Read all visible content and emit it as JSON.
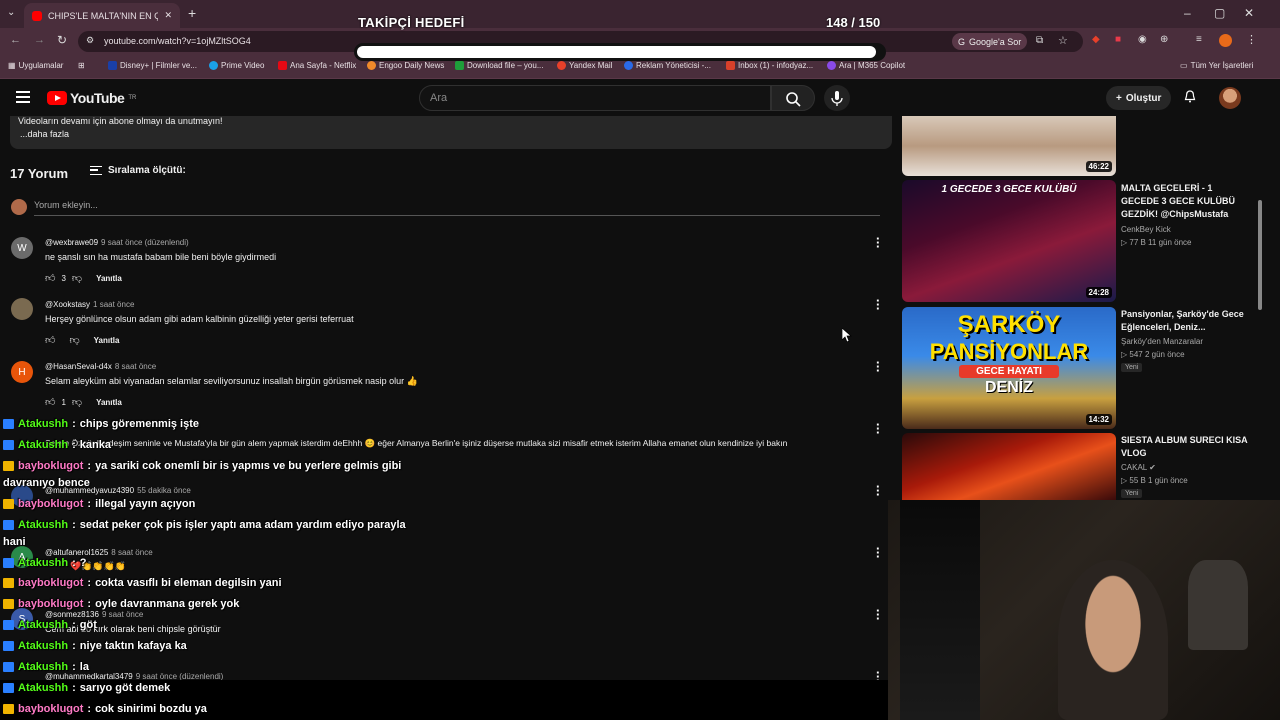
{
  "browser": {
    "tab_title": "CHIPS'LE MALTA'NIN EN ÇILGIN",
    "url": "youtube.com/watch?v=1ojMZltSOG4",
    "google_button": "Google'a Sor",
    "bookmarks": [
      {
        "label": "Uygulamalar",
        "color": "#e8e0e4"
      },
      {
        "label": "Disney+ | Filmler ve...",
        "color": "#1a3fa8"
      },
      {
        "label": "Prime Video",
        "color": "#1aa0e8"
      },
      {
        "label": "Ana Sayfa - Netflix",
        "color": "#e50914"
      },
      {
        "label": "Engoo Daily News",
        "color": "#f08a2a"
      },
      {
        "label": "Download file – you...",
        "color": "#1e9e3a"
      },
      {
        "label": "Yandex Mail",
        "color": "#e8402a"
      },
      {
        "label": "Reklam Yöneticisi -...",
        "color": "#2a6ae8"
      },
      {
        "label": "Inbox (1) - infodyaz...",
        "color": "#d8402a"
      },
      {
        "label": "Ara | M365 Copilot",
        "color": "#8a4ae8"
      }
    ],
    "all_bookmarks": "Tüm Yer İşaretleri"
  },
  "overlay": {
    "goal_title": "TAKİPÇİ HEDEFİ",
    "goal_count": "148 / 150",
    "goal_progress": 0.987
  },
  "header": {
    "logo": "YouTube",
    "logo_sup": "TR",
    "search_placeholder": "Ara",
    "create_label": "Oluştur"
  },
  "description": {
    "line1": "Videoların devamı için abone olmayı da unutmayın!",
    "more": "...daha fazla"
  },
  "comments": {
    "count_label": "17 Yorum",
    "sort_label": "Sıralama ölçütü:",
    "add_placeholder": "Yorum ekleyin...",
    "items": [
      {
        "avatar": "W",
        "avatar_color": "#6b6b6b",
        "user": "@wexbrawe09",
        "meta": "9 saat önce (düzenlendi)",
        "text": "ne şanslı sın ha mustafa babam bile beni böyle giydirmedi",
        "likes": "3",
        "reply": "Yanıtla"
      },
      {
        "avatar": "",
        "avatar_color": "#7a6a50",
        "user": "@Xookstasy",
        "meta": "1 saat önce",
        "text": "Herşey gönlünce olsun adam gibi adam kalbinin güzelliği yeter gerisi teferruat",
        "likes": "",
        "reply": "Yanıtla"
      },
      {
        "avatar": "H",
        "avatar_color": "#e8550a",
        "user": "@HasanSeval-d4x",
        "meta": "8 saat önce",
        "text": "Selam aleyküm abi viyanadan selamlar seviliyorsunuz insallah birgün görüsmek nasip olur 👍",
        "likes": "1",
        "reply": "Yanıtla"
      },
      {
        "avatar": "",
        "avatar_color": "#3a3a3a",
        "user": "",
        "meta": "",
        "text": "Selam Özgür kardeşim seninle ve Mustafa'yla bir gün alem yapmak isterdim deEhhh 😊 eğer Almanya Berlin'e işiniz düşerse mutlaka sizi misafir etmek isterim Allaha emanet olun kendinize iyi bakın",
        "likes": "",
        "reply": ""
      },
      {
        "avatar": "",
        "avatar_color": "#2a4a8a",
        "user": "@muhammedyavuz4390",
        "meta": "55 dakika önce",
        "text": "",
        "likes": "",
        "reply": ""
      },
      {
        "avatar": "A",
        "avatar_color": "#2a8a4a",
        "user": "@altufanerol1625",
        "meta": "8 saat önce",
        "text": "❤️👏👏👏👏",
        "likes": "",
        "reply": ""
      },
      {
        "avatar": "S",
        "avatar_color": "#3a5aa8",
        "user": "@sonmez8136",
        "meta": "9 saat önce",
        "text": "Cem abi 10 kırk olarak beni chipsle görüştür",
        "likes": "",
        "reply": ""
      },
      {
        "avatar": "",
        "avatar_color": "#5a5a5a",
        "user": "@muhammedkartal3479",
        "meta": "9 saat önce (düzenlendi)",
        "text": "",
        "likes": "",
        "reply": ""
      }
    ]
  },
  "chat": [
    {
      "user": "Atakushh",
      "badge": "blue",
      "text": "chips göremenmiş işte"
    },
    {
      "user": "Atakushh",
      "badge": "blue",
      "text": "kanka"
    },
    {
      "user": "bayboklugot",
      "badge": "gold",
      "text": "ya sariki cok onemli bir is yapmıs ve bu yerlere gelmis gibi"
    },
    {
      "user": "",
      "badge": "",
      "text": "davranıyo bence"
    },
    {
      "user": "bayboklugot",
      "badge": "gold",
      "text": "illegal yayın açıyon"
    },
    {
      "user": "Atakushh",
      "badge": "blue",
      "text": "sedat peker çok pis işler yaptı ama adam yardım ediyo parayla"
    },
    {
      "user": "",
      "badge": "",
      "text": "hani"
    },
    {
      "user": "Atakushh",
      "badge": "blue",
      "text": "?"
    },
    {
      "user": "bayboklugot",
      "badge": "gold",
      "text": "cokta vasıflı bi eleman degilsin yani"
    },
    {
      "user": "bayboklugot",
      "badge": "gold",
      "text": "oyle davranmana gerek yok"
    },
    {
      "user": "Atakushh",
      "badge": "blue",
      "text": "göt"
    },
    {
      "user": "Atakushh",
      "badge": "blue",
      "text": "niye taktın kafaya ka"
    },
    {
      "user": "Atakushh",
      "badge": "blue",
      "text": "la"
    },
    {
      "user": "Atakushh",
      "badge": "blue",
      "text": "sarıyo göt demek"
    },
    {
      "user": "bayboklugot",
      "badge": "gold",
      "text": "cok sinirimi bozdu ya"
    }
  ],
  "sidebar": [
    {
      "duration": "46:22",
      "title": "",
      "channel": "",
      "meta": "",
      "new": ""
    },
    {
      "duration": "24:28",
      "title": "MALTA GECELERİ - 1 GECEDE 3 GECE KULÜBÜ GEZDİK! @ChipsMustafa",
      "channel": "CenkBey Kick",
      "meta": "▷ 77 B   11 gün önce",
      "new": ""
    },
    {
      "duration": "14:32",
      "title": "Pansiyonlar, Şarköy'de Gece Eğlenceleri, Deniz...",
      "channel": "Şarköy'den Manzaralar",
      "meta": "▷ 547   2 gün önce",
      "new": "Yeni"
    },
    {
      "duration": "",
      "title": "SIESTA ALBUM SURECI KISA VLOG",
      "channel": "CAKAL ✔",
      "meta": "▷ 55 B   1 gün önce",
      "new": "Yeni"
    }
  ],
  "thumb_texts": {
    "t2_banner": "1 GECEDE 3 GECE KULÜBÜ",
    "t3_line1": "ŞARKÖY",
    "t3_line2": "PANSİYONLAR",
    "t3_line3": "GECE HAYATI",
    "t3_line4": "DENİZ"
  }
}
